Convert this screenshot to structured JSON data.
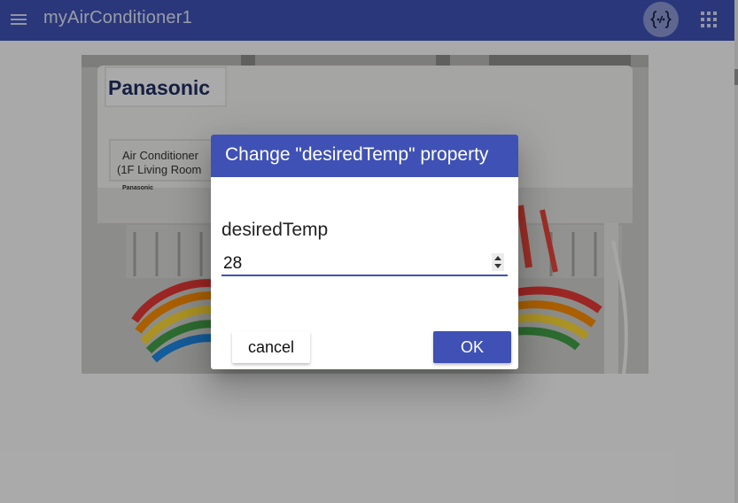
{
  "appbar": {
    "title": "myAirConditioner1",
    "menu_icon": "hamburger-menu-icon",
    "td_icon": "thing-description-icon",
    "apps_icon": "apps-grid-icon"
  },
  "device_image": {
    "brand": "Panasonic",
    "label_line1": "Air Conditioner",
    "label_line2": "(1F Living Room",
    "small_brand": "Panasonic"
  },
  "dialog": {
    "title": "Change \"desiredTemp\" property",
    "field_label": "desiredTemp",
    "field_value": "28",
    "cancel_label": "cancel",
    "ok_label": "OK"
  },
  "colors": {
    "primary": "#3f51b5",
    "overlay": "rgba(0,0,0,0.32)"
  }
}
